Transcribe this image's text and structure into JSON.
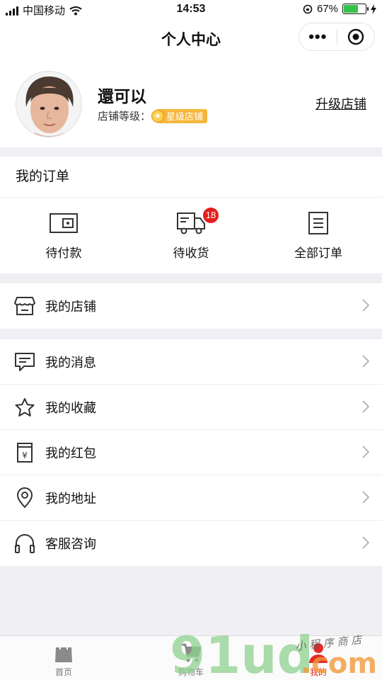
{
  "status_bar": {
    "carrier": "中国移动",
    "time": "14:53",
    "battery_percent": "67%",
    "battery_level": 0.67
  },
  "nav": {
    "title": "个人中心"
  },
  "profile": {
    "name": "還可以",
    "level_label": "店铺等级：",
    "level_badge": "星级店铺",
    "upgrade_label": "升级店铺"
  },
  "orders": {
    "title": "我的订单",
    "items": [
      {
        "label": "待付款",
        "icon": "wallet-icon"
      },
      {
        "label": "待收货",
        "icon": "truck-icon",
        "badge": "18"
      },
      {
        "label": "全部订单",
        "icon": "order-list-icon"
      }
    ]
  },
  "menu": {
    "store": {
      "label": "我的店铺",
      "icon": "store-icon"
    },
    "items": [
      {
        "label": "我的消息",
        "icon": "message-icon"
      },
      {
        "label": "我的收藏",
        "icon": "star-icon"
      },
      {
        "label": "我的红包",
        "icon": "red-packet-icon"
      },
      {
        "label": "我的地址",
        "icon": "location-icon"
      },
      {
        "label": "客服咨询",
        "icon": "headset-icon"
      }
    ]
  },
  "tabbar": {
    "items": [
      {
        "label": "首页",
        "icon": "shopping-bag-icon",
        "active": false
      },
      {
        "label": "购物车",
        "icon": "cart-icon",
        "active": false
      },
      {
        "label": "我的",
        "icon": "user-icon",
        "active": true
      }
    ]
  },
  "colors": {
    "accent": "#e62a2a",
    "badge": "#f5b63a",
    "background": "#efeff4"
  },
  "watermark": {
    "text": "91ud.com",
    "subtext": "小程序商店"
  }
}
